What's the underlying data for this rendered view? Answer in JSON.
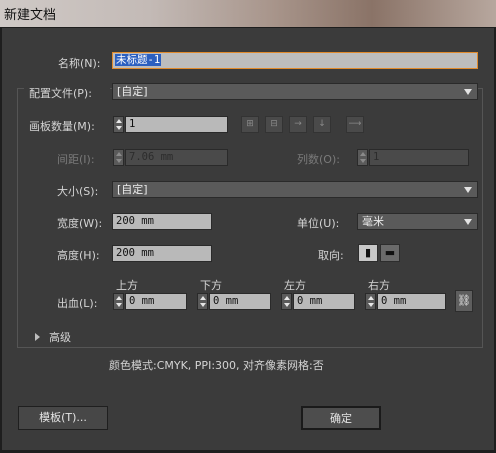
{
  "window": {
    "title": "新建文档"
  },
  "form": {
    "name_label": "名称(N):",
    "name_value": "未标题-1",
    "profile_label": "配置文件(P):",
    "profile_value": "[自定]",
    "artboards_label": "画板数量(M):",
    "artboards_value": "1",
    "spacing_label": "间距(I):",
    "spacing_value": "7.06 mm",
    "columns_label": "列数(O):",
    "columns_value": "1",
    "size_label": "大小(S):",
    "size_value": "[自定]",
    "width_label": "宽度(W):",
    "width_value": "200 mm",
    "units_label": "单位(U):",
    "units_value": "毫米",
    "height_label": "高度(H):",
    "height_value": "200 mm",
    "orientation_label": "取向:",
    "bleed_label": "出血(L):",
    "bleed": {
      "top_label": "上方",
      "top_value": "0 mm",
      "bottom_label": "下方",
      "bottom_value": "0 mm",
      "left_label": "左方",
      "left_value": "0 mm",
      "right_label": "右方",
      "right_value": "0 mm"
    },
    "advanced_label": "高级",
    "summary": "颜色模式:CMYK, PPI:300, 对齐像素网格:否"
  },
  "buttons": {
    "templates": "模板(T)...",
    "ok": "确定"
  },
  "icons": {
    "layout_buttons": [
      "grid-by-row-icon",
      "grid-by-column-icon",
      "arrange-by-row-icon",
      "arrange-by-column-icon",
      "change-to-rtl-icon"
    ],
    "orientation": [
      "portrait-icon",
      "landscape-icon"
    ],
    "link": "link-icon"
  }
}
